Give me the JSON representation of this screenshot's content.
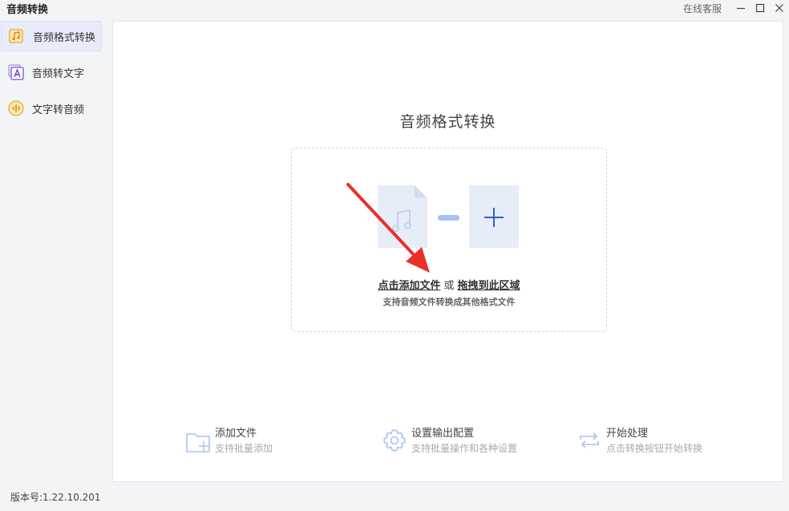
{
  "window": {
    "title": "音频转换",
    "support_label": "在线客服"
  },
  "sidebar": {
    "items": [
      {
        "label": "音频格式转换",
        "icon": "music-note-icon",
        "active": true
      },
      {
        "label": "音频转文字",
        "icon": "text-a-icon",
        "active": false
      },
      {
        "label": "文字转音频",
        "icon": "audio-bars-icon",
        "active": false
      }
    ]
  },
  "main": {
    "title": "音频格式转换",
    "dropzone": {
      "click_label": "点击添加文件",
      "or_label": "或",
      "drag_label": "拖拽到此区域",
      "hint": "支持音频文件转换成其他格式文件"
    },
    "features": [
      {
        "title": "添加文件",
        "subtitle": "支持批量添加",
        "icon": "folder-add-icon"
      },
      {
        "title": "设置输出配置",
        "subtitle": "支持批量操作和各种设置",
        "icon": "gear-icon"
      },
      {
        "title": "开始处理",
        "subtitle": "点击转换按钮开始转换",
        "icon": "refresh-icon"
      }
    ]
  },
  "footer": {
    "version": "版本号:1.22.10.201"
  },
  "colors": {
    "accent": "#2f5fd6",
    "active_bg": "#e7ecf8",
    "annotation": "#e8302a"
  }
}
